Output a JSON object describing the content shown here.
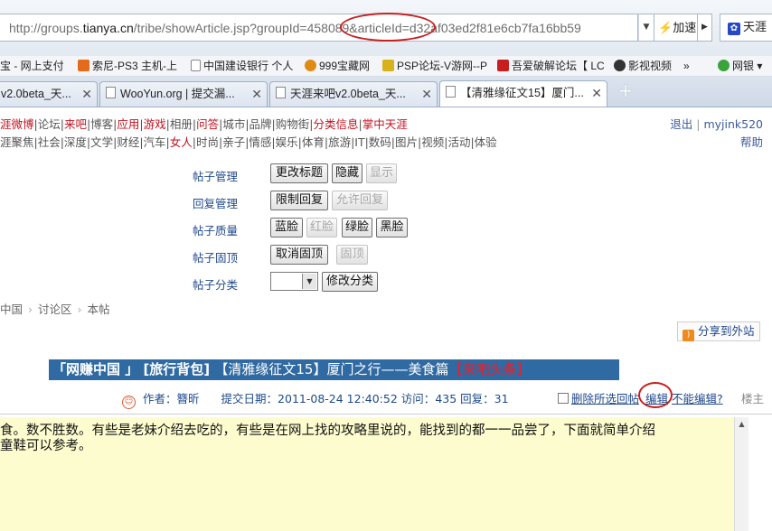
{
  "browser": {
    "url_prefix": "http://groups.",
    "url_domain": "tianya.cn",
    "url_suffix": "/tribe/showArticle.jsp?groupId=458089&articleId=d32af03ed2f81e6cb7fa16bb59",
    "speed_label": "加速",
    "search_label": "天涯"
  },
  "bookmarks": [
    {
      "label": "宝 - 网上支付",
      "color": "#ffffff"
    },
    {
      "label": "索尼-PS3 主机-上",
      "color": "#e46a1c"
    },
    {
      "label": "中国建设银行 个人",
      "color": "#ffffff"
    },
    {
      "label": "999宝藏网",
      "color": "#e08a16"
    },
    {
      "label": "PSP论坛-V游网--P",
      "color": "#d7b21a"
    },
    {
      "label": "吾爱破解论坛【 LC",
      "color": "#c81e1e"
    },
    {
      "label": "影视视频",
      "color": "#333333"
    },
    {
      "label": "»",
      "color": ""
    },
    {
      "label": "网银",
      "color": "#3aa33a"
    }
  ],
  "tabs": [
    {
      "label": "v2.0beta_天..."
    },
    {
      "label": "WooYun.org | 提交漏..."
    },
    {
      "label": "天涯来吧v2.0beta_天..."
    },
    {
      "label": "【清雅缘征文15】厦门..."
    }
  ],
  "nav": {
    "row1_a": "涯微博",
    "row1_b": "|论坛|",
    "row1_c": "来吧",
    "row1_d": "|博客|",
    "row1_e": "应用",
    "row1_f": "|",
    "row1_g": "游戏",
    "row1_h": "|相册|",
    "row1_i": "问答",
    "row1_j": "|城市|品牌|购物街|",
    "row1_k": "分类信息",
    "row1_l": "|",
    "row1_m": "掌中天涯",
    "row2_a": "涯聚焦|社会|深度|文学|财经|汽车|",
    "row2_b": "女人",
    "row2_c": "|时尚|亲子|情感|娱乐|体育|旅游|IT|数码|图片|视频|活动|体验",
    "logout": "退出",
    "sep": " | ",
    "username": "myjink520",
    "help": "帮助"
  },
  "manage": {
    "labels": [
      "帖子管理",
      "回复管理",
      "帖子质量",
      "帖子固顶",
      "帖子分类"
    ],
    "post_mgmt": [
      "更改标题",
      "隐藏",
      "显示"
    ],
    "reply_mgmt": [
      "限制回复",
      "允许回复"
    ],
    "quality": [
      "蓝脸",
      "红脸",
      "绿脸",
      "黑脸"
    ],
    "pin": [
      "取消固顶",
      "固顶"
    ],
    "category_button": "修改分类"
  },
  "breadcrumb": [
    "中国",
    "讨论区",
    "本帖"
  ],
  "post": {
    "share": "分享到外站",
    "title_prefix": "「网赚中国 」 [旅行背包] ",
    "title_topic": "【清雅缘征文15】厦门之行——美食篇",
    "title_tag": "【来吧头条】",
    "author_label": "作者：",
    "author": "簪昕",
    "date_label": "提交日期：",
    "date": "2011-08-24 12:40:52",
    "views_label": "访问：",
    "views": "435",
    "replies_label": "回复：",
    "replies": "31",
    "delete_selected": "删除所选回帖",
    "edit": "编辑",
    "cant_edit": "不能编辑?",
    "floor": "楼主",
    "body_line1": "食。数不胜数。有些是老妹介绍去吃的，有些是在网上找的攻略里说的，能找到的都一一品尝了，下面就简单介绍",
    "body_line2": "童鞋可以参考。"
  }
}
